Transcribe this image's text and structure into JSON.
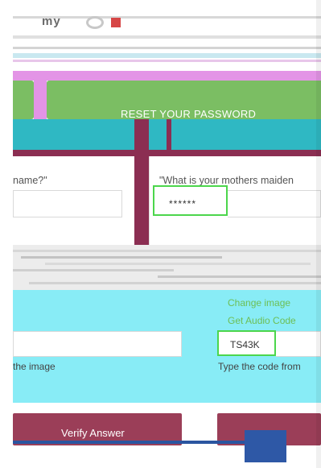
{
  "header": {
    "logo_text": "my"
  },
  "reset": {
    "title": "RESET YOUR PASSWORD"
  },
  "questions": {
    "left_label": "name?\"",
    "right_label": "\"What is your mothers maiden",
    "right_value": "******"
  },
  "captcha": {
    "change_image": "Change image",
    "audio_code": "Get Audio Code",
    "code_value": "TS43K",
    "hint_left": "the image",
    "hint_right": "Type the code from"
  },
  "actions": {
    "verify_label": "Verify Answer"
  },
  "colors": {
    "green": "#7bbe63",
    "teal": "#2fb8c3",
    "maroon": "#8b2e52",
    "cyan_panel": "#88ecf6",
    "focus_green": "#4cd64c",
    "link_green": "#6dbf54",
    "button": "#9b3e58",
    "blue": "#2e58a6",
    "pink": "#e394e6"
  }
}
